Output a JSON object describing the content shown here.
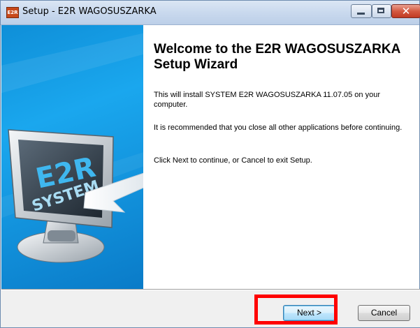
{
  "window": {
    "title": "Setup - E2R WAGOSUSZARKA",
    "app_icon_text": "E2R"
  },
  "caption_buttons": {
    "minimize_icon": "minimize-icon",
    "maximize_icon": "maximize-icon",
    "close_glyph": "✕"
  },
  "artwork": {
    "logo_text_1": "E2R",
    "logo_text_2": "SYSTEM"
  },
  "content": {
    "title": "Welcome to the E2R WAGOSUSZARKA Setup Wizard",
    "para1": "This will install SYSTEM E2R WAGOSUSZARKA 11.07.05 on your computer.",
    "para2": "It is recommended that you close all other applications before continuing.",
    "para3": "Click Next to continue, or Cancel to exit Setup."
  },
  "buttons": {
    "next": "Next >",
    "cancel": "Cancel"
  },
  "colors": {
    "panel_blue": "#1aa7ee",
    "highlight_red": "#ff0000"
  }
}
